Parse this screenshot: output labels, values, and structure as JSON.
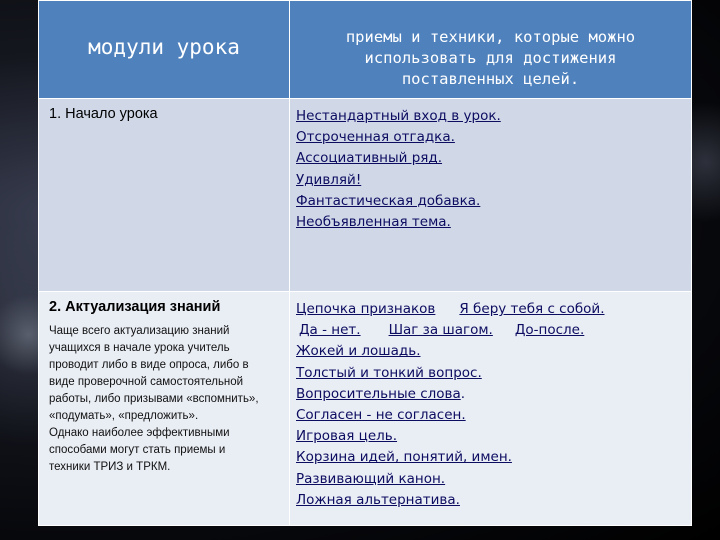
{
  "header": {
    "col1": "модули урока",
    "col2_line1": "приемы и техники, которые можно",
    "col2_line2": "использовать для достижения",
    "col2_line3": "поставленных целей."
  },
  "rows": [
    {
      "module": "1. Начало урока",
      "techniques": [
        "Нестандартный вход в урок.",
        "Отсроченная отгадка.",
        "Ассоциативный ряд.",
        "Удивляй!",
        "Фантастическая добавка.",
        "Необъявленная тема."
      ]
    },
    {
      "module": "2. Актуализация знаний",
      "note": [
        "Чаще всего актуализацию знаний",
        "учащихся в начале урока учитель",
        "проводит либо в виде опроса, либо в",
        "виде проверочной самостоятельной",
        "работы, либо призывами «вспомнить»,",
        "«подумать», «предложить».",
        "Однако наиболее эффективными",
        "способами могут стать приемы и",
        "техники ТРИЗ и ТРКМ."
      ],
      "line1": [
        "Цепочка признаков",
        "Я беру тебя с собой."
      ],
      "line2": [
        "Да - нет.",
        "Шаг за шагом.",
        "До-после."
      ],
      "techniques": [
        "Жокей и лошадь.",
        "Толстый и тонкий вопрос.",
        "Вопросительные слова",
        "Согласен - не согласен.",
        "Игровая цель.",
        "Корзина идей, понятий, имен.",
        "Развивающий канон.",
        "Ложная альтернатива."
      ],
      "period": "."
    }
  ]
}
